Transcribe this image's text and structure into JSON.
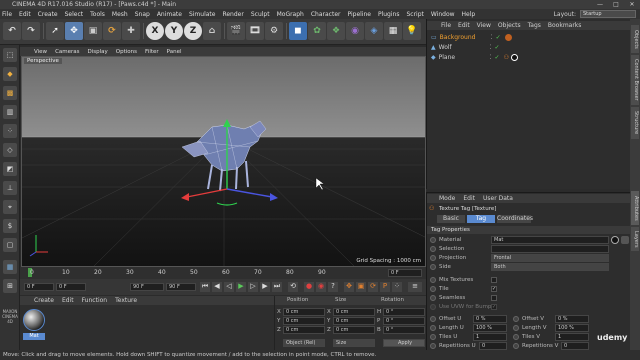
{
  "window": {
    "title": "CINEMA 4D R17.016 Studio (R17) - [Paws.c4d *] - Main",
    "minimize": "—",
    "maximize": "□",
    "close": "✕"
  },
  "menu": [
    "File",
    "Edit",
    "Create",
    "Select",
    "Tools",
    "Mesh",
    "Snap",
    "Animate",
    "Simulate",
    "Render",
    "Sculpt",
    "MoGraph",
    "Character",
    "Pipeline",
    "Plugins",
    "Script",
    "Window",
    "Help"
  ],
  "layout": {
    "label": "Layout:",
    "value": "Startup"
  },
  "toolbar": {
    "x": "X",
    "y": "Y",
    "z": "Z"
  },
  "viewport": {
    "menu": [
      "View",
      "Cameras",
      "Display",
      "Options",
      "Filter",
      "Panel"
    ],
    "label": "Perspective",
    "grid_spacing": "Grid Spacing : 1000 cm"
  },
  "timeline": {
    "ticks": [
      "0",
      "10",
      "20",
      "30",
      "40",
      "50",
      "60",
      "70",
      "80",
      "90"
    ],
    "frame": "0 F"
  },
  "timectl": {
    "start": "0 F",
    "current": "0 F",
    "end": "90 F",
    "preview": "90 F"
  },
  "material_manager": {
    "menu": [
      "Create",
      "Edit",
      "Function",
      "Texture"
    ],
    "material_name": "Mat"
  },
  "coord_manager": {
    "headers": [
      "Position",
      "Size",
      "Rotation"
    ],
    "rows": [
      {
        "axis_p": "X",
        "pos": "0 cm",
        "axis_s": "X",
        "size": "0 cm",
        "axis_r": "H",
        "rot": "0 °"
      },
      {
        "axis_p": "Y",
        "pos": "0 cm",
        "axis_s": "Y",
        "size": "0 cm",
        "axis_r": "P",
        "rot": "0 °"
      },
      {
        "axis_p": "Z",
        "pos": "0 cm",
        "axis_s": "Z",
        "size": "0 cm",
        "axis_r": "B",
        "rot": "0 °"
      }
    ],
    "mode": "Object (Rel)",
    "size_mode": "Size",
    "apply": "Apply"
  },
  "object_manager": {
    "menu": [
      "File",
      "Edit",
      "View",
      "Objects",
      "Tags",
      "Bookmarks"
    ],
    "objects": [
      {
        "name": "Background",
        "selected": true
      },
      {
        "name": "Wolf",
        "selected": false
      },
      {
        "name": "Plane",
        "selected": false
      }
    ]
  },
  "attribute_manager": {
    "menu": [
      "Mode",
      "Edit",
      "User Data"
    ],
    "title": "Texture Tag [Texture]",
    "tabs": [
      "Basic",
      "Tag",
      "Coordinates"
    ],
    "active_tab": "Tag",
    "section": "Tag Properties",
    "fields": [
      {
        "label": "Material",
        "value": "Mat"
      },
      {
        "label": "Selection",
        "value": ""
      },
      {
        "label": "Projection",
        "value": "Frontal"
      },
      {
        "label": "Side",
        "value": "Both"
      }
    ],
    "checks": [
      {
        "label": "Mix Textures",
        "checked": false
      },
      {
        "label": "Tile",
        "checked": true
      },
      {
        "label": "Seamless",
        "checked": false
      },
      {
        "label": "Use UVW for Bump",
        "checked": true
      }
    ],
    "offsets": [
      {
        "l1": "Offset U",
        "v1": "0 %",
        "l2": "Offset V",
        "v2": "0 %"
      },
      {
        "l1": "Length U",
        "v1": "100 %",
        "l2": "Length V",
        "v2": "100 %"
      },
      {
        "l1": "Tiles U",
        "v1": "1",
        "l2": "Tiles V",
        "v2": "1"
      },
      {
        "l1": "Repetitions U",
        "v1": "0",
        "l2": "Repetitions V",
        "v2": "0"
      }
    ]
  },
  "right_tabs": [
    "Objects",
    "Content Browser",
    "Structure",
    "Attributes",
    "Layers"
  ],
  "status": "Move: Click and drag to move elements. Hold down SHIFT to quantize movement / add to the selection in point mode, CTRL to remove.",
  "watermark": "udemy",
  "brand": "MAXON CINEMA 4D"
}
